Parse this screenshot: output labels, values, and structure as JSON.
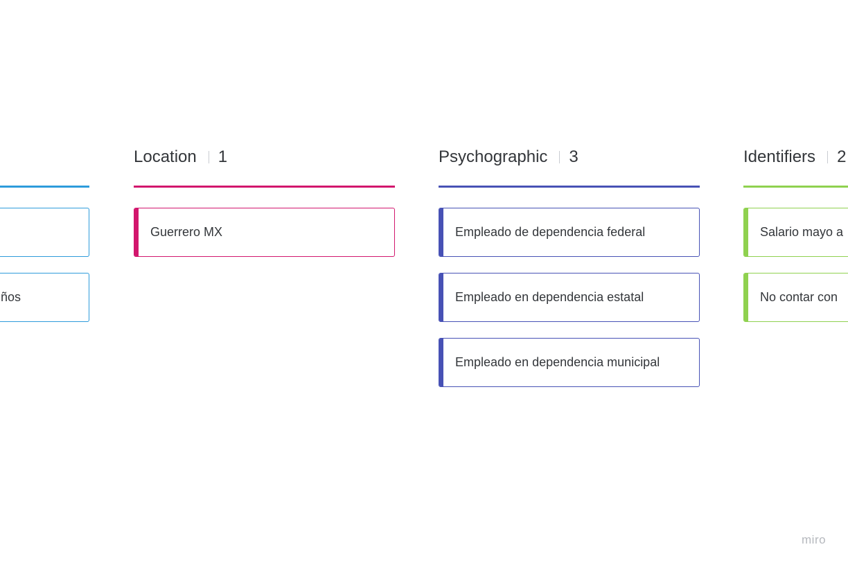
{
  "board": {
    "columns": [
      {
        "title": "",
        "count": "",
        "color": "#2d9bdb",
        "cards": [
          {
            "text": ""
          },
          {
            "text": "ños"
          }
        ]
      },
      {
        "title": "Location",
        "count": "1",
        "color": "#d2166d",
        "cards": [
          {
            "text": "Guerrero MX"
          }
        ]
      },
      {
        "title": "Psychographic",
        "count": "3",
        "color": "#4751b5",
        "cards": [
          {
            "text": "Empleado de dependencia federal"
          },
          {
            "text": "Empleado en dependencia estatal"
          },
          {
            "text": "Empleado en dependencia municipal"
          }
        ]
      },
      {
        "title": "Identifiers",
        "count": "2",
        "color": "#8fd14f",
        "cards": [
          {
            "text": "Salario mayo a"
          },
          {
            "text": "No contar con"
          }
        ]
      }
    ]
  },
  "footer": {
    "logo_text": "miro"
  }
}
